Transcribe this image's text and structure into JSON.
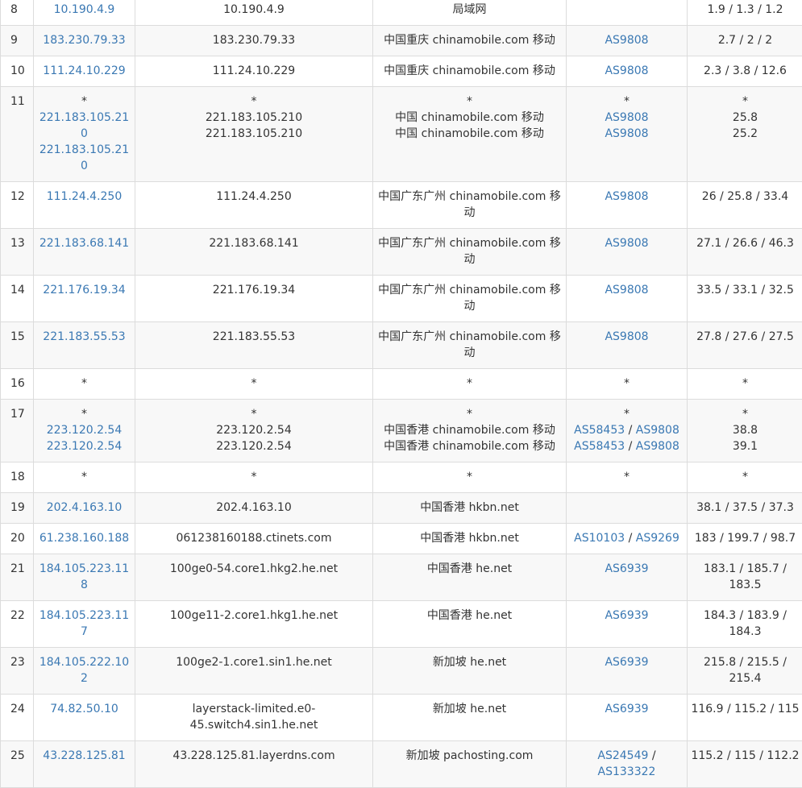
{
  "colors": {
    "link": "#3a78b3",
    "text": "#333333",
    "border": "#dcdcdc",
    "row_alt": "#f8f8f8"
  },
  "rows": [
    {
      "hop": "8",
      "ip": [
        "10.190.4.9"
      ],
      "host": [
        "10.190.4.9"
      ],
      "location": [
        "局域网"
      ],
      "asn": [
        []
      ],
      "latency": [
        "1.9 / 1.3 / 1.2"
      ]
    },
    {
      "hop": "9",
      "ip": [
        "183.230.79.33"
      ],
      "host": [
        "183.230.79.33"
      ],
      "location": [
        "中国重庆 chinamobile.com 移动"
      ],
      "asn": [
        [
          "AS9808"
        ]
      ],
      "latency": [
        "2.7 / 2 / 2"
      ]
    },
    {
      "hop": "10",
      "ip": [
        "111.24.10.229"
      ],
      "host": [
        "111.24.10.229"
      ],
      "location": [
        "中国重庆 chinamobile.com 移动"
      ],
      "asn": [
        [
          "AS9808"
        ]
      ],
      "latency": [
        "2.3 / 3.8 / 12.6"
      ]
    },
    {
      "hop": "11",
      "ip": [
        "*",
        "221.183.105.210",
        "221.183.105.210"
      ],
      "host": [
        "*",
        "221.183.105.210",
        "221.183.105.210"
      ],
      "location": [
        "*",
        "中国 chinamobile.com 移动",
        "中国 chinamobile.com 移动"
      ],
      "asn": [
        [
          "*"
        ],
        [
          "AS9808"
        ],
        [
          "AS9808"
        ]
      ],
      "latency": [
        "*",
        "25.8",
        "25.2"
      ]
    },
    {
      "hop": "12",
      "ip": [
        "111.24.4.250"
      ],
      "host": [
        "111.24.4.250"
      ],
      "location": [
        "中国广东广州 chinamobile.com 移动"
      ],
      "asn": [
        [
          "AS9808"
        ]
      ],
      "latency": [
        "26 / 25.8 / 33.4"
      ]
    },
    {
      "hop": "13",
      "ip": [
        "221.183.68.141"
      ],
      "host": [
        "221.183.68.141"
      ],
      "location": [
        "中国广东广州 chinamobile.com 移动"
      ],
      "asn": [
        [
          "AS9808"
        ]
      ],
      "latency": [
        "27.1 / 26.6 / 46.3"
      ]
    },
    {
      "hop": "14",
      "ip": [
        "221.176.19.34"
      ],
      "host": [
        "221.176.19.34"
      ],
      "location": [
        "中国广东广州 chinamobile.com 移动"
      ],
      "asn": [
        [
          "AS9808"
        ]
      ],
      "latency": [
        "33.5 / 33.1 / 32.5"
      ]
    },
    {
      "hop": "15",
      "ip": [
        "221.183.55.53"
      ],
      "host": [
        "221.183.55.53"
      ],
      "location": [
        "中国广东广州 chinamobile.com 移动"
      ],
      "asn": [
        [
          "AS9808"
        ]
      ],
      "latency": [
        "27.8 / 27.6 / 27.5"
      ]
    },
    {
      "hop": "16",
      "ip": [
        "*"
      ],
      "host": [
        "*"
      ],
      "location": [
        "*"
      ],
      "asn": [
        [
          "*"
        ]
      ],
      "latency": [
        "*"
      ]
    },
    {
      "hop": "17",
      "ip": [
        "*",
        "223.120.2.54",
        "223.120.2.54"
      ],
      "host": [
        "*",
        "223.120.2.54",
        "223.120.2.54"
      ],
      "location": [
        "*",
        "中国香港 chinamobile.com 移动",
        "中国香港 chinamobile.com 移动"
      ],
      "asn": [
        [
          "*"
        ],
        [
          "AS58453",
          "AS9808"
        ],
        [
          "AS58453",
          "AS9808"
        ]
      ],
      "latency": [
        "*",
        "38.8",
        "39.1"
      ]
    },
    {
      "hop": "18",
      "ip": [
        "*"
      ],
      "host": [
        "*"
      ],
      "location": [
        "*"
      ],
      "asn": [
        [
          "*"
        ]
      ],
      "latency": [
        "*"
      ]
    },
    {
      "hop": "19",
      "ip": [
        "202.4.163.10"
      ],
      "host": [
        "202.4.163.10"
      ],
      "location": [
        "中国香港 hkbn.net"
      ],
      "asn": [
        []
      ],
      "latency": [
        "38.1 / 37.5 / 37.3"
      ]
    },
    {
      "hop": "20",
      "ip": [
        "61.238.160.188"
      ],
      "host": [
        "061238160188.ctinets.com"
      ],
      "location": [
        "中国香港 hkbn.net"
      ],
      "asn": [
        [
          "AS10103",
          "AS9269"
        ]
      ],
      "latency": [
        "183 / 199.7 / 98.7"
      ]
    },
    {
      "hop": "21",
      "ip": [
        "184.105.223.118"
      ],
      "host": [
        "100ge0-54.core1.hkg2.he.net"
      ],
      "location": [
        "中国香港 he.net"
      ],
      "asn": [
        [
          "AS6939"
        ]
      ],
      "latency": [
        "183.1 / 185.7 / 183.5"
      ]
    },
    {
      "hop": "22",
      "ip": [
        "184.105.223.117"
      ],
      "host": [
        "100ge11-2.core1.hkg1.he.net"
      ],
      "location": [
        "中国香港 he.net"
      ],
      "asn": [
        [
          "AS6939"
        ]
      ],
      "latency": [
        "184.3 / 183.9 / 184.3"
      ]
    },
    {
      "hop": "23",
      "ip": [
        "184.105.222.102"
      ],
      "host": [
        "100ge2-1.core1.sin1.he.net"
      ],
      "location": [
        "新加坡 he.net"
      ],
      "asn": [
        [
          "AS6939"
        ]
      ],
      "latency": [
        "215.8 / 215.5 / 215.4"
      ]
    },
    {
      "hop": "24",
      "ip": [
        "74.82.50.10"
      ],
      "host": [
        "layerstack-limited.e0-45.switch4.sin1.he.net"
      ],
      "location": [
        "新加坡 he.net"
      ],
      "asn": [
        [
          "AS6939"
        ]
      ],
      "latency": [
        "116.9 / 115.2 / 115"
      ]
    },
    {
      "hop": "25",
      "ip": [
        "43.228.125.81"
      ],
      "host": [
        "43.228.125.81.layerdns.com"
      ],
      "location": [
        "新加坡 pachosting.com"
      ],
      "asn": [
        [
          "AS24549",
          "AS133322"
        ]
      ],
      "latency": [
        "115.2 / 115 / 112.2"
      ]
    }
  ]
}
